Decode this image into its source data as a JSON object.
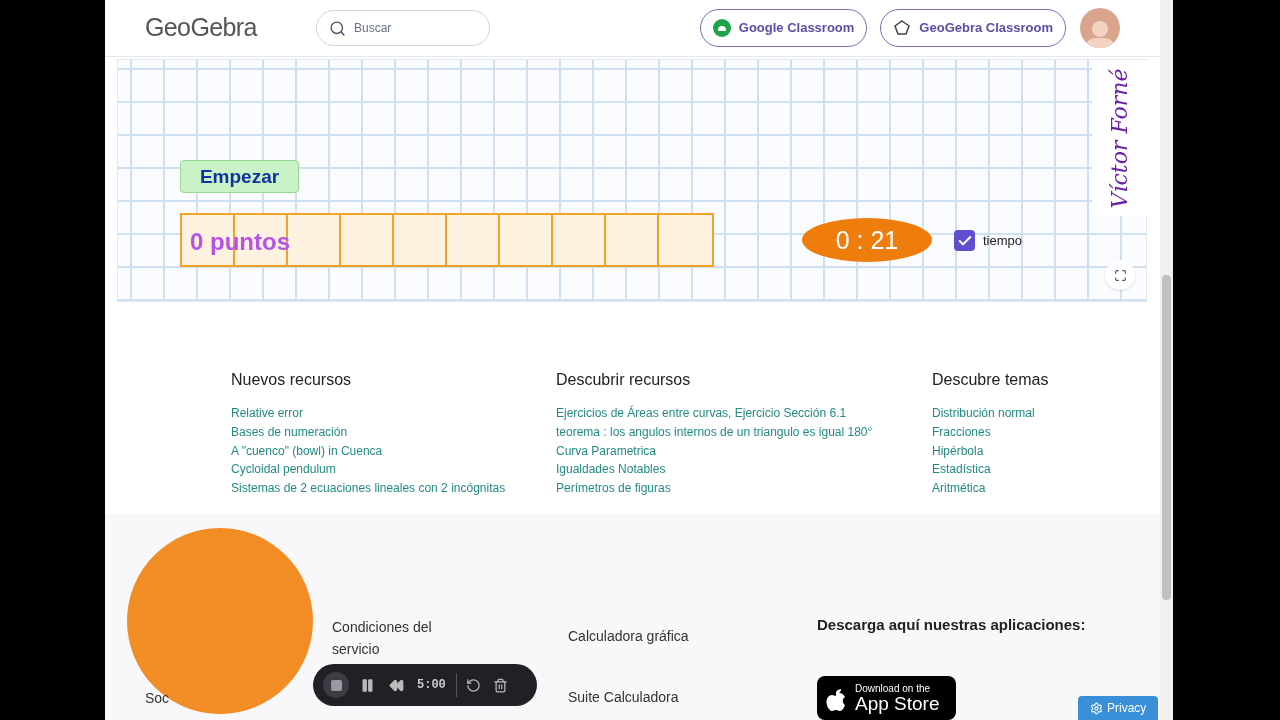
{
  "header": {
    "logo": "GeoGebra",
    "search": {
      "placeholder": "Buscar"
    },
    "buttons": [
      "Google Classroom",
      "GeoGebra Classroom"
    ]
  },
  "applet": {
    "start_button": "Empezar",
    "score": "0 puntos",
    "timer": "0 : 21",
    "time_checkbox": {
      "label": "tiempo",
      "checked": true
    },
    "signature": "Víctor Forné"
  },
  "link_columns": [
    {
      "title": "Nuevos recursos",
      "links": [
        "Relative error",
        "Bases de numeración",
        "A \"cuenco\" (bowl) in Cuenca",
        "Cycloidal pendulum",
        "Sistemas de 2 ecuaciones lineales con 2 incógnitas"
      ]
    },
    {
      "title": "Descubrir recursos",
      "links": [
        "Ejercicios de Áreas entre curvas, Ejercicio Sección 6.1",
        "teorema : los angulos internos de un triangulo es igual 180°",
        "Curva Parametrica",
        "Igualdades Notables",
        "Perímetros de figuras"
      ]
    },
    {
      "title": "Descubre temas",
      "links": [
        "Distribución normal",
        "Fracciones",
        "Hipérbola",
        "Estadística",
        "Aritmética"
      ]
    }
  ],
  "footer": {
    "column_1": [
      "Soc"
    ],
    "column_2": [
      "Condiciones del servicio"
    ],
    "column_3": [
      "Calculadora gráfica",
      "Suite Calculadora"
    ],
    "download_title": "Descarga aquí nuestras aplicaciones:",
    "app_store": {
      "small": "Download on the",
      "large": "App Store"
    }
  },
  "recorder": {
    "time": "5:00"
  },
  "privacy_button": "Privacy"
}
